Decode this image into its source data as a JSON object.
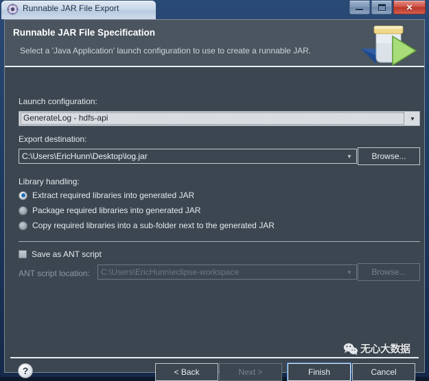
{
  "window": {
    "title": "Runnable JAR File Export",
    "icon": "eclipse-gear-icon",
    "controls": {
      "minimize": "Minimize",
      "restore": "Restore",
      "close": "Close",
      "close_glyph": "✕"
    }
  },
  "banner": {
    "title": "Runnable JAR File Specification",
    "subtitle": "Select a 'Java Application' launch configuration to use to create a runnable JAR.",
    "icon": "jar-export-icon"
  },
  "form": {
    "launch_configuration": {
      "label": "Launch configuration:",
      "label_mnemonic": "L",
      "value": "GenerateLog - hdfs-api",
      "arrow": "▼"
    },
    "export_destination": {
      "label": "Export destination:",
      "label_mnemonic": "d",
      "value": "C:\\Users\\EricHunn\\Desktop\\log.jar",
      "arrow": "▼",
      "browse_label": "Browse...",
      "browse_mnemonic": "r"
    },
    "library_handling": {
      "label": "Library handling:",
      "options": [
        {
          "label": "Extract required libraries into generated JAR",
          "mnemonic": "E",
          "selected": true
        },
        {
          "label": "Package required libraries into generated JAR",
          "mnemonic": "P",
          "selected": false
        },
        {
          "label": "Copy required libraries into a sub-folder next to the generated JAR",
          "mnemonic": "C",
          "selected": false
        }
      ]
    },
    "ant": {
      "save_label": "Save as ANT script",
      "save_mnemonic": "S",
      "checked": false,
      "location_label": "ANT script location:",
      "location_mnemonic": "A",
      "location_value": "C:\\Users\\EricHunn\\eclipse-workspace",
      "arrow": "▼",
      "browse_label": "Browse...",
      "browse_mnemonic": "o",
      "disabled": true
    }
  },
  "footer": {
    "help": "?",
    "buttons": [
      {
        "label": "< Back",
        "mnemonic": "B",
        "disabled": false,
        "focused": false
      },
      {
        "label": "Next >",
        "mnemonic": "N",
        "disabled": true,
        "focused": false
      },
      {
        "label": "Finish",
        "mnemonic": "F",
        "disabled": false,
        "focused": true
      },
      {
        "label": "Cancel",
        "mnemonic": "C",
        "disabled": false,
        "focused": false
      }
    ]
  },
  "watermark": {
    "text": "无心大数据",
    "logo": "wechat-icon"
  },
  "colors": {
    "dialog_bg": "#3b4650",
    "banner_bg": "#4a555f",
    "accent": "#4a90d9",
    "radio_dot": "#1f6fb5",
    "close_red": "#cf4f42"
  }
}
